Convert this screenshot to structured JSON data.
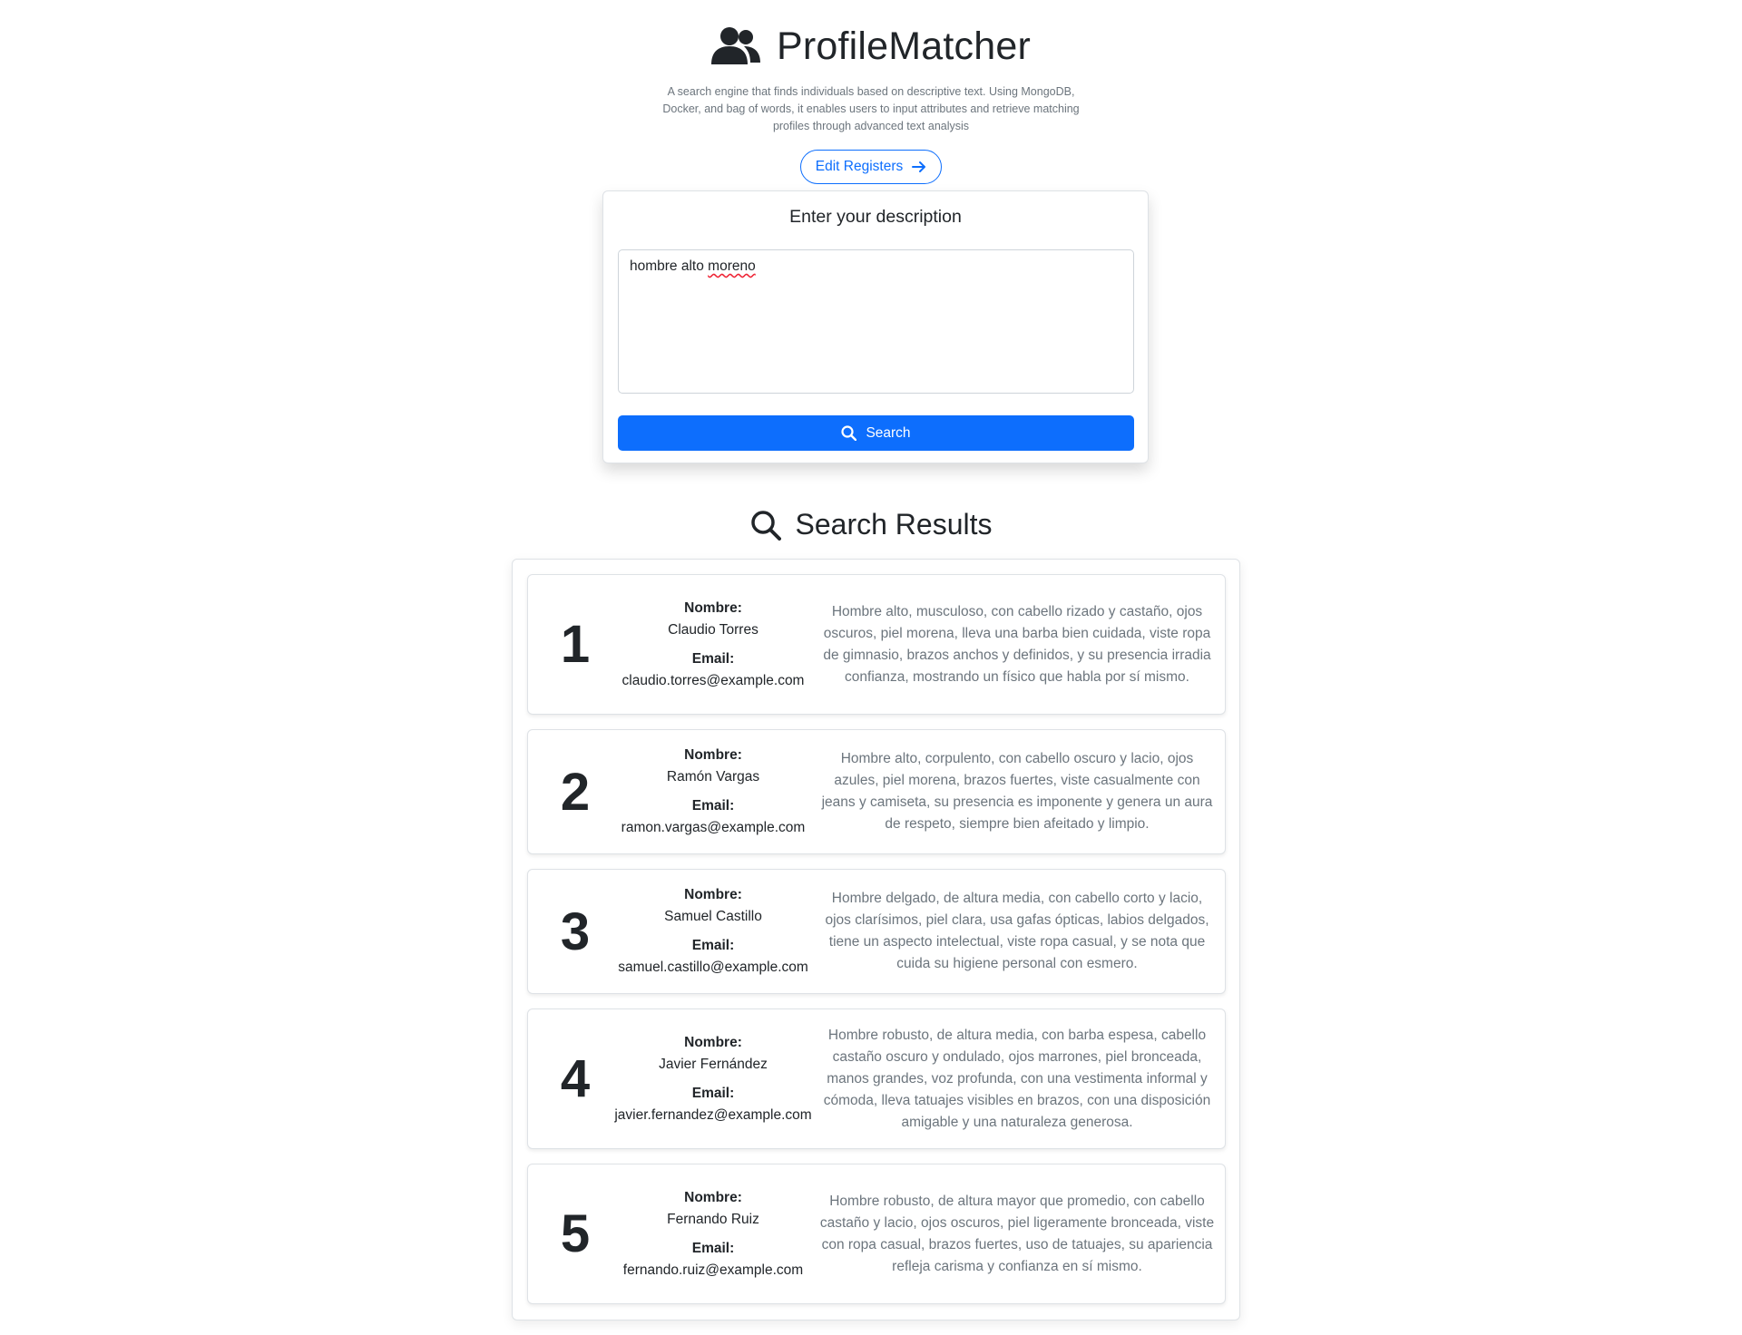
{
  "header": {
    "title": "ProfileMatcher",
    "icon": "users-icon",
    "subtitle": "A search engine that finds individuals based on descriptive text. Using MongoDB, Docker, and bag of words, it enables users to input attributes and retrieve matching profiles through advanced text analysis",
    "edit_button_label": "Edit Registers",
    "edit_button_icon": "arrow-right-icon"
  },
  "search": {
    "card_title": "Enter your description",
    "query_text_plain": "hombre alto ",
    "query_text_flagged": "moreno",
    "button_label": "Search",
    "button_icon": "search-icon"
  },
  "results": {
    "heading": "Search Results",
    "heading_icon": "search-icon",
    "name_label": "Nombre:",
    "email_label": "Email:",
    "items": [
      {
        "rank": "1",
        "name": "Claudio Torres",
        "email": "claudio.torres@example.com",
        "description": "Hombre alto, musculoso, con cabello rizado y castaño, ojos oscuros, piel morena, lleva una barba bien cuidada, viste ropa de gimnasio, brazos anchos y definidos, y su presencia irradia confianza, mostrando un físico que habla por sí mismo."
      },
      {
        "rank": "2",
        "name": "Ramón Vargas",
        "email": "ramon.vargas@example.com",
        "description": "Hombre alto, corpulento, con cabello oscuro y lacio, ojos azules, piel morena, brazos fuertes, viste casualmente con jeans y camiseta, su presencia es imponente y genera un aura de respeto, siempre bien afeitado y limpio."
      },
      {
        "rank": "3",
        "name": "Samuel Castillo",
        "email": "samuel.castillo@example.com",
        "description": "Hombre delgado, de altura media, con cabello corto y lacio, ojos clarísimos, piel clara, usa gafas ópticas, labios delgados, tiene un aspecto intelectual, viste ropa casual, y se nota que cuida su higiene personal con esmero."
      },
      {
        "rank": "4",
        "name": "Javier Fernández",
        "email": "javier.fernandez@example.com",
        "description": "Hombre robusto, de altura media, con barba espesa, cabello castaño oscuro y ondulado, ojos marrones, piel bronceada, manos grandes, voz profunda, con una vestimenta informal y cómoda, lleva tatuajes visibles en brazos, con una disposición amigable y una naturaleza generosa."
      },
      {
        "rank": "5",
        "name": "Fernando Ruiz",
        "email": "fernando.ruiz@example.com",
        "description": "Hombre robusto, de altura mayor que promedio, con cabello castaño y lacio, ojos oscuros, piel ligeramente bronceada, viste con ropa casual, brazos fuertes, uso de tatuajes, su apariencia refleja carisma y confianza en sí mismo."
      }
    ]
  },
  "colors": {
    "primary": "#0d6efd",
    "text": "#212529",
    "muted": "#6c757d",
    "border": "#dee2e6"
  }
}
